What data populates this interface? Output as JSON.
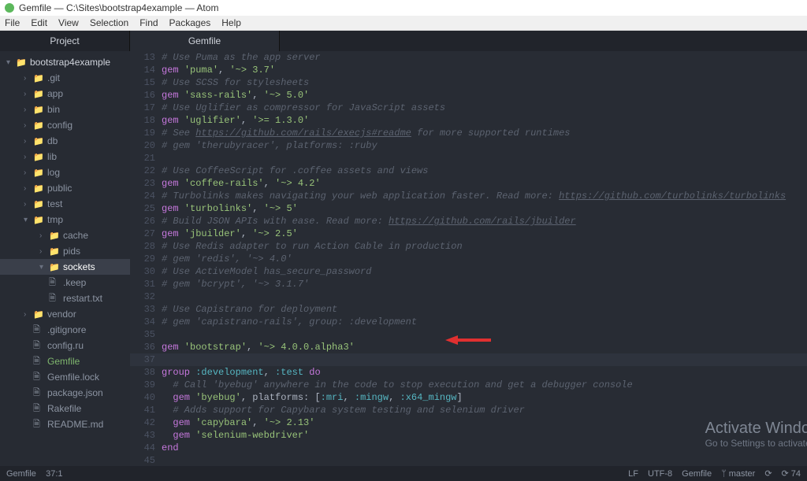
{
  "title": "Gemfile — C:\\Sites\\bootstrap4example — Atom",
  "menu": [
    "File",
    "Edit",
    "View",
    "Selection",
    "Find",
    "Packages",
    "Help"
  ],
  "projectHeader": "Project",
  "tree": [
    {
      "depth": "root",
      "chev": "▾",
      "icon": "folder",
      "label": "bootstrap4example",
      "cls": ""
    },
    {
      "depth": "d1",
      "chev": "›",
      "icon": "folder",
      "label": ".git",
      "cls": ""
    },
    {
      "depth": "d1",
      "chev": "›",
      "icon": "folder",
      "label": "app",
      "cls": ""
    },
    {
      "depth": "d1",
      "chev": "›",
      "icon": "folder",
      "label": "bin",
      "cls": ""
    },
    {
      "depth": "d1",
      "chev": "›",
      "icon": "folder",
      "label": "config",
      "cls": ""
    },
    {
      "depth": "d1",
      "chev": "›",
      "icon": "folder",
      "label": "db",
      "cls": ""
    },
    {
      "depth": "d1",
      "chev": "›",
      "icon": "folder",
      "label": "lib",
      "cls": ""
    },
    {
      "depth": "d1",
      "chev": "›",
      "icon": "folder",
      "label": "log",
      "cls": ""
    },
    {
      "depth": "d1",
      "chev": "›",
      "icon": "folder",
      "label": "public",
      "cls": ""
    },
    {
      "depth": "d1",
      "chev": "›",
      "icon": "folder",
      "label": "test",
      "cls": ""
    },
    {
      "depth": "d1",
      "chev": "▾",
      "icon": "folder",
      "label": "tmp",
      "cls": ""
    },
    {
      "depth": "d2",
      "chev": "›",
      "icon": "folder",
      "label": "cache",
      "cls": ""
    },
    {
      "depth": "d2",
      "chev": "›",
      "icon": "folder",
      "label": "pids",
      "cls": ""
    },
    {
      "depth": "d2",
      "chev": "▾",
      "icon": "folder",
      "label": "sockets",
      "cls": "selected"
    },
    {
      "depth": "d2",
      "chev": "",
      "icon": "file",
      "label": ".keep",
      "cls": ""
    },
    {
      "depth": "d2",
      "chev": "",
      "icon": "file",
      "label": "restart.txt",
      "cls": ""
    },
    {
      "depth": "d1",
      "chev": "›",
      "icon": "folder",
      "label": "vendor",
      "cls": ""
    },
    {
      "depth": "d1",
      "chev": "",
      "icon": "file",
      "label": ".gitignore",
      "cls": ""
    },
    {
      "depth": "d1",
      "chev": "",
      "icon": "file",
      "label": "config.ru",
      "cls": ""
    },
    {
      "depth": "d1",
      "chev": "",
      "icon": "file",
      "label": "Gemfile",
      "cls": "mod"
    },
    {
      "depth": "d1",
      "chev": "",
      "icon": "file",
      "label": "Gemfile.lock",
      "cls": ""
    },
    {
      "depth": "d1",
      "chev": "",
      "icon": "file",
      "label": "package.json",
      "cls": ""
    },
    {
      "depth": "d1",
      "chev": "",
      "icon": "file",
      "label": "Rakefile",
      "cls": ""
    },
    {
      "depth": "d1",
      "chev": "",
      "icon": "file",
      "label": "README.md",
      "cls": ""
    }
  ],
  "tab": "Gemfile",
  "code": [
    {
      "n": 13,
      "html": "<span class='cm'># Use Puma as the app server</span>"
    },
    {
      "n": 14,
      "html": "<span class='kw'>gem</span> <span class='str'>'puma'</span><span class='pl'>, </span><span class='str'>'~> 3.7'</span>"
    },
    {
      "n": 15,
      "html": "<span class='cm'># Use SCSS for stylesheets</span>"
    },
    {
      "n": 16,
      "html": "<span class='kw'>gem</span> <span class='str'>'sass-rails'</span><span class='pl'>, </span><span class='str'>'~> 5.0'</span>"
    },
    {
      "n": 17,
      "html": "<span class='cm'># Use Uglifier as compressor for JavaScript assets</span>"
    },
    {
      "n": 18,
      "html": "<span class='kw'>gem</span> <span class='str'>'uglifier'</span><span class='pl'>, </span><span class='str'>'>= 1.3.0'</span>"
    },
    {
      "n": 19,
      "html": "<span class='cm'># See </span><span class='lnk'>https://github.com/rails/execjs#readme</span><span class='cm'> for more supported runtimes</span>"
    },
    {
      "n": 20,
      "html": "<span class='cm'># gem 'therubyracer', platforms: :ruby</span>"
    },
    {
      "n": 21,
      "html": ""
    },
    {
      "n": 22,
      "html": "<span class='cm'># Use CoffeeScript for .coffee assets and views</span>"
    },
    {
      "n": 23,
      "html": "<span class='kw'>gem</span> <span class='str'>'coffee-rails'</span><span class='pl'>, </span><span class='str'>'~> 4.2'</span>"
    },
    {
      "n": 24,
      "html": "<span class='cm'># Turbolinks makes navigating your web application faster. Read more: </span><span class='lnk'>https://github.com/turbolinks/turbolinks</span>"
    },
    {
      "n": 25,
      "html": "<span class='kw'>gem</span> <span class='str'>'turbolinks'</span><span class='pl'>, </span><span class='str'>'~> 5'</span>"
    },
    {
      "n": 26,
      "html": "<span class='cm'># Build JSON APIs with ease. Read more: </span><span class='lnk'>https://github.com/rails/jbuilder</span>"
    },
    {
      "n": 27,
      "html": "<span class='kw'>gem</span> <span class='str'>'jbuilder'</span><span class='pl'>, </span><span class='str'>'~> 2.5'</span>"
    },
    {
      "n": 28,
      "html": "<span class='cm'># Use Redis adapter to run Action Cable in production</span>"
    },
    {
      "n": 29,
      "html": "<span class='cm'># gem 'redis', '~> 4.0'</span>"
    },
    {
      "n": 30,
      "html": "<span class='cm'># Use ActiveModel has_secure_password</span>"
    },
    {
      "n": 31,
      "html": "<span class='cm'># gem 'bcrypt', '~> 3.1.7'</span>"
    },
    {
      "n": 32,
      "html": ""
    },
    {
      "n": 33,
      "html": "<span class='cm'># Use Capistrano for deployment</span>"
    },
    {
      "n": 34,
      "html": "<span class='cm'># gem 'capistrano-rails', group: :development</span>"
    },
    {
      "n": 35,
      "html": ""
    },
    {
      "n": 36,
      "html": "<span class='kw'>gem</span> <span class='str'>'bootstrap'</span><span class='pl'>, </span><span class='str'>'~> 4.0.0.alpha3'</span>"
    },
    {
      "n": 37,
      "html": "",
      "current": true
    },
    {
      "n": 38,
      "html": "<span class='kw'>group</span> <span class='sym'>:development</span><span class='pl'>, </span><span class='sym'>:test</span> <span class='kw'>do</span>"
    },
    {
      "n": 39,
      "html": "  <span class='cm'># Call 'byebug' anywhere in the code to stop execution and get a debugger console</span>"
    },
    {
      "n": 40,
      "html": "  <span class='kw'>gem</span> <span class='str'>'byebug'</span><span class='pl'>, platforms: [</span><span class='sym'>:mri</span><span class='pl'>, </span><span class='sym'>:mingw</span><span class='pl'>, </span><span class='sym'>:x64_mingw</span><span class='pl'>]</span>"
    },
    {
      "n": 41,
      "html": "  <span class='cm'># Adds support for Capybara system testing and selenium driver</span>"
    },
    {
      "n": 42,
      "html": "  <span class='kw'>gem</span> <span class='str'>'capybara'</span><span class='pl'>, </span><span class='str'>'~> 2.13'</span>"
    },
    {
      "n": 43,
      "html": "  <span class='kw'>gem</span> <span class='str'>'selenium-webdriver'</span>"
    },
    {
      "n": 44,
      "html": "<span class='kw'>end</span>"
    },
    {
      "n": 45,
      "html": ""
    }
  ],
  "watermark": {
    "big": "Activate Windows",
    "small": "Go to Settings to activate Windows."
  },
  "status": {
    "file": "Gemfile",
    "pos": "37:1",
    "lf": "LF",
    "enc": "UTF-8",
    "grammar": "Gemfile",
    "branch": "master",
    "fetch": "⟳",
    "updates": "74"
  }
}
